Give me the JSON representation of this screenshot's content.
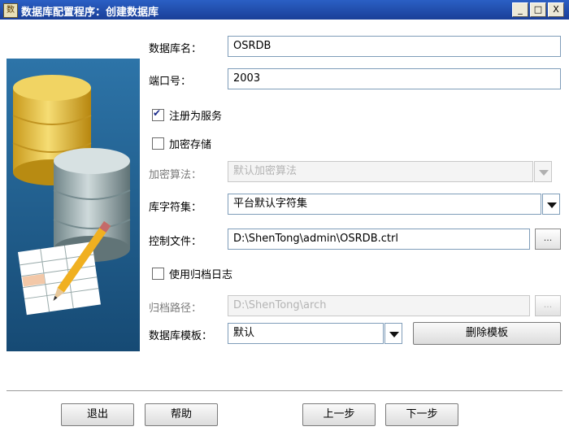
{
  "window": {
    "title": "数据库配置程序：创建数据库",
    "app_icon": "数",
    "controls": [
      "_",
      "□",
      "X"
    ]
  },
  "form": {
    "db_name_label": "数据库名：",
    "db_name_value": "OSRDB",
    "port_label": "端口号：",
    "port_value": "2003",
    "register_service_label": "注册为服务",
    "register_service_checked": true,
    "encrypt_storage_label": "加密存储",
    "encrypt_storage_checked": false,
    "encrypt_algo_label": "加密算法：",
    "encrypt_algo_value": "默认加密算法",
    "charset_label": "库字符集：",
    "charset_value": "平台默认字符集",
    "control_file_label": "控制文件：",
    "control_file_value": "D:\\ShenTong\\admin\\OSRDB.ctrl",
    "browse_label": "...",
    "use_archive_label": "使用归档日志",
    "use_archive_checked": false,
    "archive_path_label": "归档路径：",
    "archive_path_value": "D:\\ShenTong\\arch",
    "template_label": "数据库模板：",
    "template_value": "默认",
    "delete_template_label": "删除模板"
  },
  "footer": {
    "exit_label": "退出",
    "help_label": "帮助",
    "prev_label": "上一步",
    "next_label": "下一步"
  },
  "colors": {
    "title_bar": "#1f4fb0",
    "art_background": "#1f5d8e",
    "gold_cylinder": "#e8c23a",
    "gray_cylinder": "#9aa9ad"
  }
}
